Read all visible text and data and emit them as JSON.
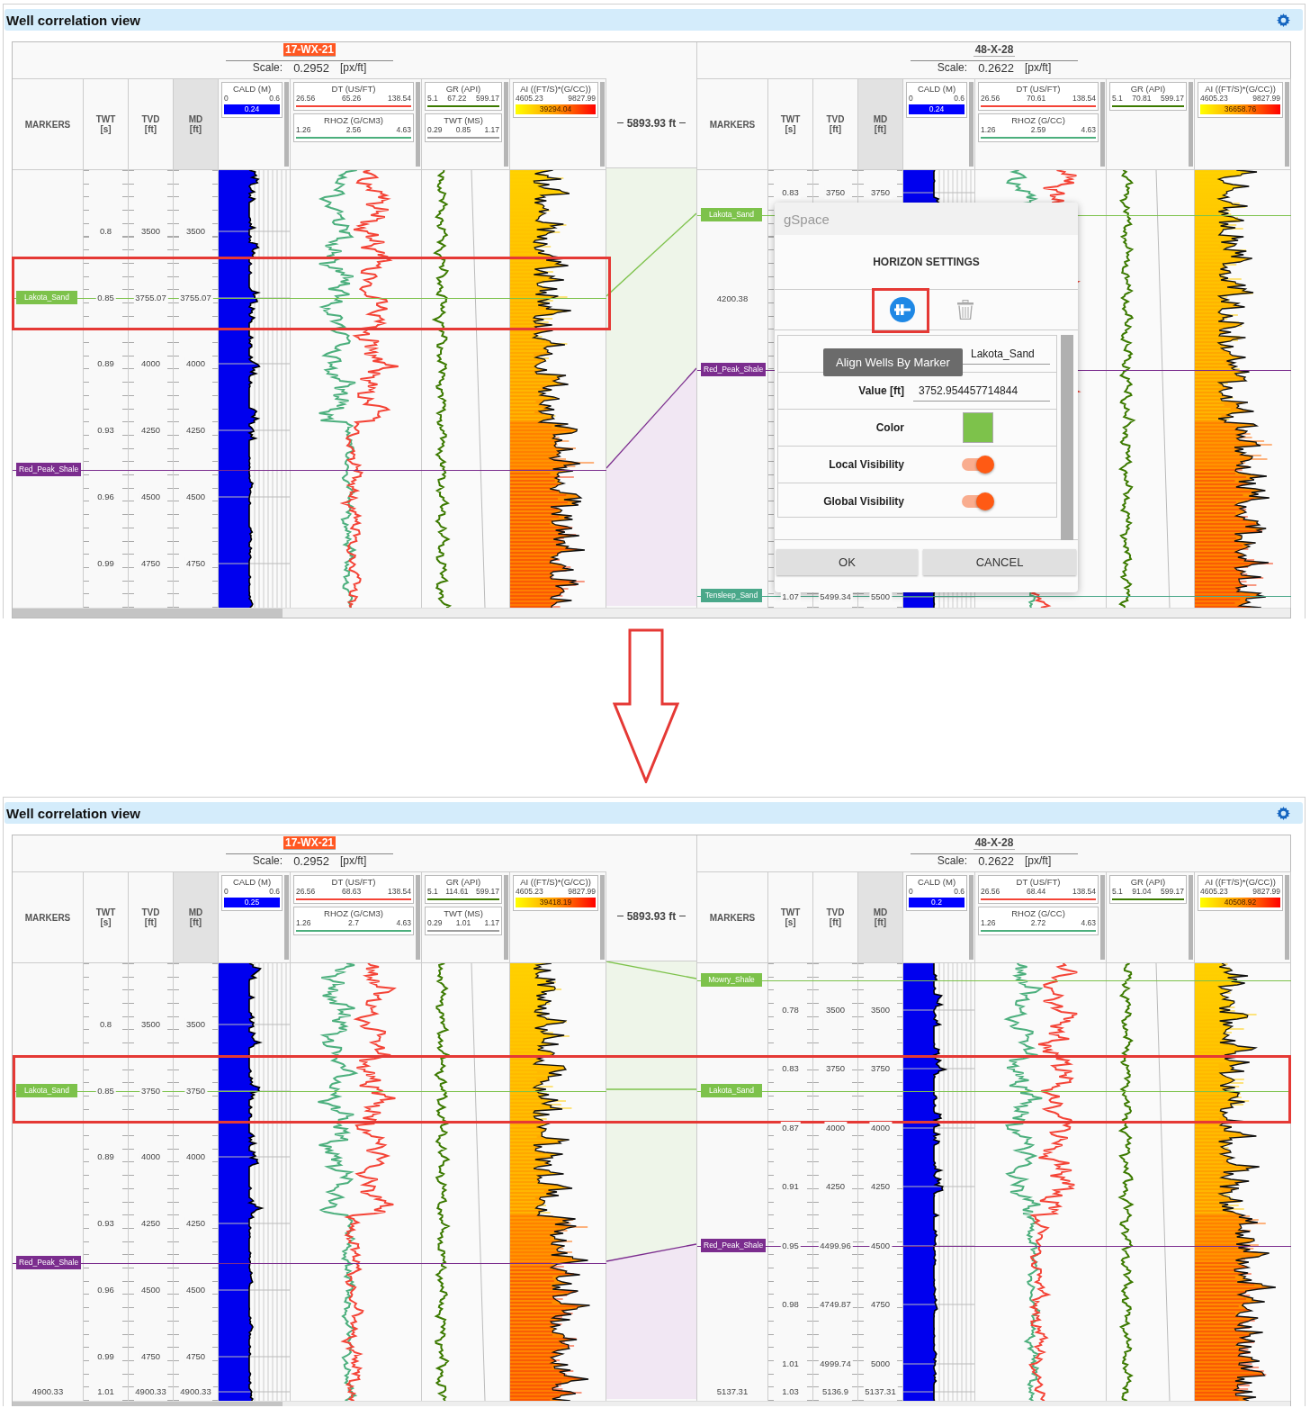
{
  "panels": [
    {
      "title": "Well correlation view",
      "distance": "5893.93 ft",
      "wells": [
        {
          "name": "17-WX-21",
          "highlighted": true,
          "scale_label": "Scale:",
          "scale": "0.2952",
          "scale_unit": "[px/ft]",
          "columns": [
            {
              "label": "MARKERS",
              "selected": false
            },
            {
              "label": "TWT",
              "unit": "[s]",
              "selected": false
            },
            {
              "label": "TVD",
              "unit": "[ft]",
              "selected": false
            },
            {
              "label": "MD",
              "unit": "[ft]",
              "selected": true
            }
          ],
          "tracks": [
            {
              "kind": "caliper",
              "logs": [
                {
                  "kind": "bar",
                  "name": "CALD (M)",
                  "min": "0",
                  "max": "0.6",
                  "value": "0.24",
                  "color": "#0000ff"
                }
              ]
            },
            {
              "kind": "dual",
              "logs": [
                {
                  "kind": "line",
                  "name": "DT (US/FT)",
                  "min": "26.56",
                  "max": "138.54",
                  "value": "65.26",
                  "color": "#f44336"
                },
                {
                  "kind": "line",
                  "name": "RHOZ (G/CM3)",
                  "min": "1.26",
                  "max": "4.63",
                  "value": "2.56",
                  "color": "#4caf7d"
                }
              ]
            },
            {
              "kind": "gamma",
              "logs": [
                {
                  "kind": "line",
                  "name": "GR (API)",
                  "min": "5.1",
                  "max": "599.17",
                  "value": "67.22",
                  "color": "#3c7a00"
                },
                {
                  "kind": "line",
                  "name": "TWT (MS)",
                  "min": "0.29",
                  "max": "1.17",
                  "value": "0.85",
                  "color": "#9e9e9e"
                }
              ]
            },
            {
              "kind": "impedance",
              "logs": [
                {
                  "kind": "gradient",
                  "name": "AI ((FT/S)*(G/CC))",
                  "min": "4605.23",
                  "max": "9827.99",
                  "value": "39294.04"
                }
              ]
            }
          ],
          "markers": [
            {
              "name": "Lakota_Sand",
              "color": "#7dc24b"
            },
            {
              "name": "Red_Peak_Shale",
              "color": "#7b2d8e"
            }
          ],
          "depth_rows": [
            {
              "twt": "0.8",
              "tvd": "3500",
              "md": "3500"
            },
            {
              "twt": "0.85",
              "tvd": "3755.07",
              "md": "3755.07"
            },
            {
              "twt": "0.89",
              "tvd": "4000",
              "md": "4000"
            },
            {
              "twt": "0.93",
              "tvd": "4250",
              "md": "4250"
            },
            {
              "twt": "0.96",
              "tvd": "4500",
              "md": "4500"
            },
            {
              "twt": "0.99",
              "tvd": "4750",
              "md": "4750"
            }
          ]
        },
        {
          "name": "48-X-28",
          "highlighted": false,
          "scale_label": "Scale:",
          "scale": "0.2622",
          "scale_unit": "[px/ft]",
          "columns": [
            {
              "label": "MARKERS",
              "selected": false
            },
            {
              "label": "TWT",
              "unit": "[s]",
              "selected": false
            },
            {
              "label": "TVD",
              "unit": "[ft]",
              "selected": false
            },
            {
              "label": "MD",
              "unit": "[ft]",
              "selected": true
            }
          ],
          "tracks": [
            {
              "kind": "caliper",
              "logs": [
                {
                  "kind": "bar",
                  "name": "CALD (M)",
                  "min": "0",
                  "max": "0.6",
                  "value": "0.24",
                  "color": "#0000ff"
                }
              ]
            },
            {
              "kind": "dual",
              "logs": [
                {
                  "kind": "line",
                  "name": "DT (US/FT)",
                  "min": "26.56",
                  "max": "138.54",
                  "value": "70.61",
                  "color": "#f44336"
                },
                {
                  "kind": "line",
                  "name": "RHOZ (G/CC)",
                  "min": "1.26",
                  "max": "4.63",
                  "value": "2.59",
                  "color": "#4caf7d"
                }
              ]
            },
            {
              "kind": "gamma",
              "logs": [
                {
                  "kind": "line",
                  "name": "GR (API)",
                  "min": "5.1",
                  "max": "599.17",
                  "value": "70.81",
                  "color": "#3c7a00"
                }
              ]
            },
            {
              "kind": "impedance",
              "logs": [
                {
                  "kind": "gradient",
                  "name": "AI ((FT/S)*(G/CC))",
                  "min": "4605.23",
                  "max": "9827.99",
                  "value": "36658.76"
                }
              ]
            }
          ],
          "markers": [
            {
              "name": "Lakota_Sand",
              "color": "#7dc24b"
            },
            {
              "name": "Red_Peak_Shale",
              "color": "#7b2d8e"
            },
            {
              "name": "Tensleep_Sand",
              "color": "#4aa88a"
            }
          ],
          "depth_rows": [
            {
              "twt": "0.83",
              "tvd": "3750",
              "md": "3750"
            },
            {
              "markers_col": "4200.38"
            },
            {
              "twt": "1.07",
              "tvd": "5499.34",
              "md": "5500"
            }
          ]
        }
      ],
      "dialog": {
        "title": "gSpace",
        "heading": "HORIZON SETTINGS",
        "tooltip": "Align Wells By Marker",
        "fields": [
          {
            "kind": "text",
            "value": "Lakota_Sand"
          },
          {
            "kind": "text",
            "label": "Value [ft]",
            "value": "3752.954457714844"
          },
          {
            "kind": "color",
            "label": "Color",
            "color": "#7dc24b"
          },
          {
            "kind": "toggle",
            "label": "Local Visibility",
            "on": true
          },
          {
            "kind": "toggle",
            "label": "Global Visibility",
            "on": true
          }
        ],
        "buttons": [
          "OK",
          "CANCEL"
        ]
      }
    },
    {
      "title": "Well correlation view",
      "distance": "5893.93 ft",
      "wells": [
        {
          "name": "17-WX-21",
          "highlighted": true,
          "scale_label": "Scale:",
          "scale": "0.2952",
          "scale_unit": "[px/ft]",
          "columns": [
            {
              "label": "MARKERS",
              "selected": false
            },
            {
              "label": "TWT",
              "unit": "[s]",
              "selected": false
            },
            {
              "label": "TVD",
              "unit": "[ft]",
              "selected": false
            },
            {
              "label": "MD",
              "unit": "[ft]",
              "selected": true
            }
          ],
          "tracks": [
            {
              "kind": "caliper",
              "logs": [
                {
                  "kind": "bar",
                  "name": "CALD (M)",
                  "min": "0",
                  "max": "0.6",
                  "value": "0.25",
                  "color": "#0000ff"
                }
              ]
            },
            {
              "kind": "dual",
              "logs": [
                {
                  "kind": "line",
                  "name": "DT (US/FT)",
                  "min": "26.56",
                  "max": "138.54",
                  "value": "68.63",
                  "color": "#f44336"
                },
                {
                  "kind": "line",
                  "name": "RHOZ (G/CM3)",
                  "min": "1.26",
                  "max": "4.63",
                  "value": "2.7",
                  "color": "#4caf7d"
                }
              ]
            },
            {
              "kind": "gamma",
              "logs": [
                {
                  "kind": "line",
                  "name": "GR (API)",
                  "min": "5.1",
                  "max": "599.17",
                  "value": "114.61",
                  "color": "#3c7a00"
                },
                {
                  "kind": "line",
                  "name": "TWT (MS)",
                  "min": "0.29",
                  "max": "1.17",
                  "value": "1.01",
                  "color": "#9e9e9e"
                }
              ]
            },
            {
              "kind": "impedance",
              "logs": [
                {
                  "kind": "gradient",
                  "name": "AI ((FT/S)*(G/CC))",
                  "min": "4605.23",
                  "max": "9827.99",
                  "value": "39418.19"
                }
              ]
            }
          ],
          "markers": [
            {
              "name": "Lakota_Sand",
              "color": "#7dc24b"
            },
            {
              "name": "Red_Peak_Shale",
              "color": "#7b2d8e"
            }
          ],
          "depth_rows": [
            {
              "twt": "0.8",
              "tvd": "3500",
              "md": "3500"
            },
            {
              "twt": "0.85",
              "tvd": "3750",
              "md": "3750"
            },
            {
              "twt": "0.89",
              "tvd": "4000",
              "md": "4000"
            },
            {
              "twt": "0.93",
              "tvd": "4250",
              "md": "4250"
            },
            {
              "twt": "0.96",
              "tvd": "4500",
              "md": "4500"
            },
            {
              "twt": "0.99",
              "tvd": "4750",
              "md": "4750"
            },
            {
              "markers_col": "4900.33",
              "twt": "1.01",
              "tvd": "4900.33",
              "md": "4900.33"
            }
          ]
        },
        {
          "name": "48-X-28",
          "highlighted": false,
          "scale_label": "Scale:",
          "scale": "0.2622",
          "scale_unit": "[px/ft]",
          "columns": [
            {
              "label": "MARKERS",
              "selected": false
            },
            {
              "label": "TWT",
              "unit": "[s]",
              "selected": false
            },
            {
              "label": "TVD",
              "unit": "[ft]",
              "selected": false
            },
            {
              "label": "MD",
              "unit": "[ft]",
              "selected": true
            }
          ],
          "tracks": [
            {
              "kind": "caliper",
              "logs": [
                {
                  "kind": "bar",
                  "name": "CALD (M)",
                  "min": "0",
                  "max": "0.6",
                  "value": "0.2",
                  "color": "#0000ff"
                }
              ]
            },
            {
              "kind": "dual",
              "logs": [
                {
                  "kind": "line",
                  "name": "DT (US/FT)",
                  "min": "26.56",
                  "max": "138.54",
                  "value": "68.44",
                  "color": "#f44336"
                },
                {
                  "kind": "line",
                  "name": "RHOZ (G/CC)",
                  "min": "1.26",
                  "max": "4.63",
                  "value": "2.72",
                  "color": "#4caf7d"
                }
              ]
            },
            {
              "kind": "gamma",
              "logs": [
                {
                  "kind": "line",
                  "name": "GR (API)",
                  "min": "5.1",
                  "max": "599.17",
                  "value": "91.04",
                  "color": "#3c7a00"
                }
              ]
            },
            {
              "kind": "impedance",
              "logs": [
                {
                  "kind": "gradient",
                  "name": "AI ((FT/S)*(G/CC))",
                  "min": "4605.23",
                  "max": "9827.99",
                  "value": "40508.92"
                }
              ]
            }
          ],
          "markers": [
            {
              "name": "Mowry_Shale",
              "color": "#7dc24b"
            },
            {
              "name": "Lakota_Sand",
              "color": "#7dc24b"
            },
            {
              "name": "Red_Peak_Shale",
              "color": "#7b2d8e"
            }
          ],
          "depth_rows": [
            {
              "twt": "0.78",
              "tvd": "3500",
              "md": "3500"
            },
            {
              "twt": "0.83",
              "tvd": "3750",
              "md": "3750"
            },
            {
              "twt": "0.87",
              "tvd": "4000",
              "md": "4000"
            },
            {
              "twt": "0.91",
              "tvd": "4250",
              "md": "4250"
            },
            {
              "twt": "0.95",
              "tvd": "4499.96",
              "md": "4500"
            },
            {
              "twt": "0.98",
              "tvd": "4749.87",
              "md": "4750"
            },
            {
              "twt": "1.01",
              "tvd": "4999.74",
              "md": "5000"
            },
            {
              "markers_col": "5137.31",
              "twt": "1.03",
              "tvd": "5136.9",
              "md": "5137.31"
            }
          ]
        }
      ]
    }
  ]
}
